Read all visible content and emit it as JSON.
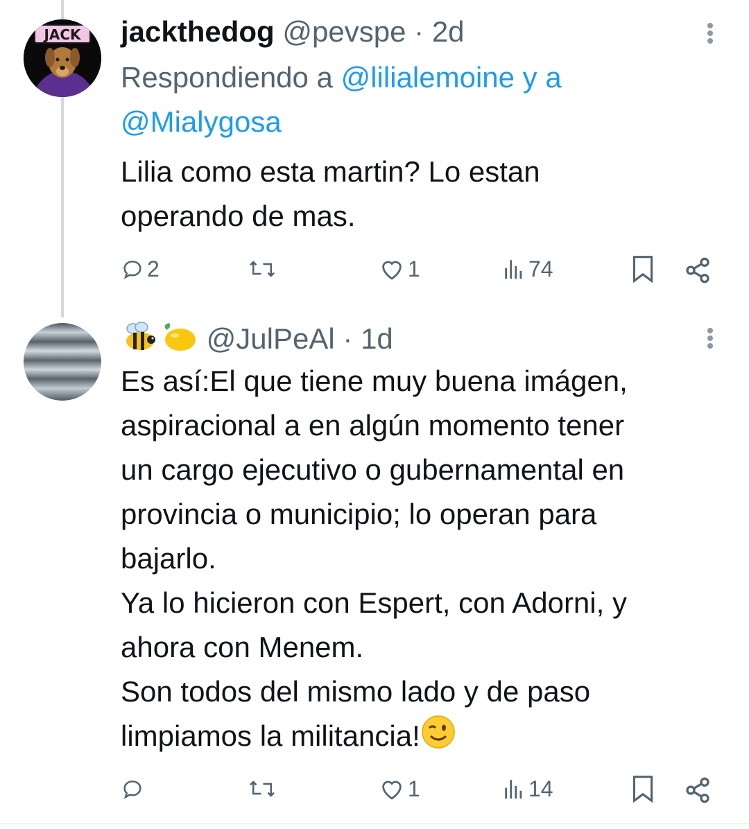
{
  "tweets": [
    {
      "username": "jackthedog",
      "handle": "@pevspe",
      "separator": "·",
      "time": "2d",
      "avatar_label": "JACK",
      "reply_prefix": "Respondiendo a",
      "reply_mention_1": "@lilialemoine",
      "reply_joiner": "y a",
      "reply_mention_2": "@Mialygosa",
      "text_lines": [
        "Lilia como esta martin? Lo estan",
        "operando de mas."
      ],
      "actions": {
        "replies": "2",
        "retweets": "",
        "likes": "1",
        "views": "74"
      }
    },
    {
      "emoji_name": [
        "bee-emoji",
        "lemon-emoji"
      ],
      "handle": "@JulPeAl",
      "separator": "·",
      "time": "1d",
      "text_lines": [
        "Es así:El que tiene muy buena imágen,",
        "aspiracional a en algún momento tener",
        "un cargo ejecutivo o gubernamental en",
        "provincia o municipio; lo operan para",
        "bajarlo.",
        "Ya lo hicieron con Espert, con Adorni, y",
        "ahora con Menem.",
        "Son todos del mismo lado y de paso",
        "limpiamos la militancia!"
      ],
      "actions": {
        "replies": "",
        "retweets": "",
        "likes": "1",
        "views": "14"
      }
    }
  ],
  "colors": {
    "link": "#1d9bf0",
    "muted": "#536471",
    "text": "#0f1419",
    "thread_line": "#cfd9de"
  },
  "icons": [
    "reply-icon",
    "retweet-icon",
    "like-icon",
    "views-icon",
    "bookmark-icon",
    "share-icon",
    "more-icon",
    "wink-emoji"
  ]
}
